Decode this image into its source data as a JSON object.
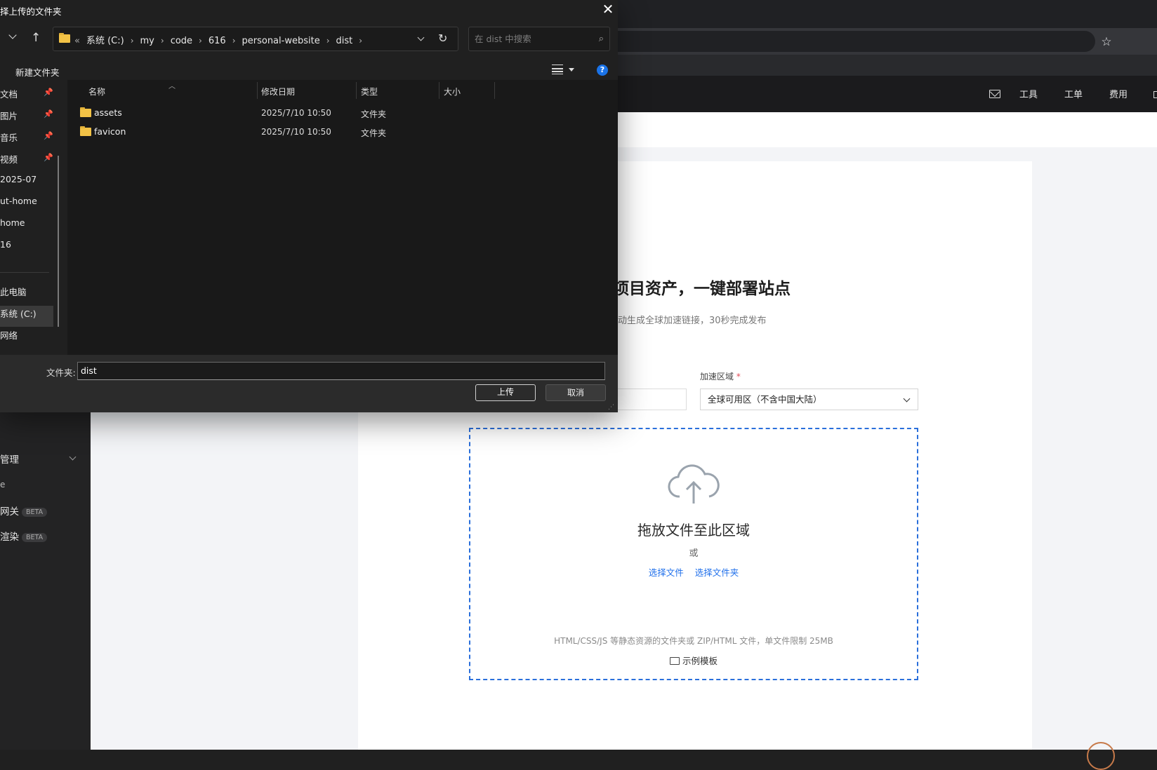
{
  "dialog": {
    "title": "择上传的文件夹",
    "close_glyph": "✕",
    "breadcrumbs": [
      "系统 (C:)",
      "my",
      "code",
      "616",
      "personal-website",
      "dist"
    ],
    "crumb_prefix": "«",
    "search_placeholder": "在 dist 中搜索",
    "new_folder": "新建文件夹",
    "help_glyph": "?",
    "sidebar": [
      {
        "label": "文档",
        "pinned": true
      },
      {
        "label": "图片",
        "pinned": true
      },
      {
        "label": "音乐",
        "pinned": true
      },
      {
        "label": "视频",
        "pinned": true
      },
      {
        "label": "2025-07"
      },
      {
        "label": "ut-home"
      },
      {
        "label": "home"
      },
      {
        "label": "16"
      },
      {
        "label": "此电脑"
      },
      {
        "label": "系统 (C:)",
        "selected": true
      },
      {
        "label": "网络"
      }
    ],
    "columns": {
      "name": "名称",
      "date": "修改日期",
      "type": "类型",
      "size": "大小"
    },
    "files": [
      {
        "name": "assets",
        "date": "2025/7/10 10:50",
        "type": "文件夹"
      },
      {
        "name": "favicon",
        "date": "2025/7/10 10:50",
        "type": "文件夹"
      }
    ],
    "folder_label": "文件夹:",
    "folder_value": "dist",
    "upload_button": "上传",
    "cancel_button": "取消"
  },
  "header": {
    "items": [
      "工具",
      "工单",
      "费用"
    ]
  },
  "left_nav": {
    "section": "管理",
    "items": [
      {
        "label": "e"
      },
      {
        "label": "网关",
        "badge": "BETA"
      },
      {
        "label": "渲染",
        "badge": "BETA"
      }
    ]
  },
  "main": {
    "title": "项目资产，一键部署站点",
    "subtitle": "动生成全球加速链接，30秒完成发布",
    "region_label": "加速区域",
    "required_mark": "*",
    "region_value": "全球可用区（不含中国大陆）",
    "dropzone": {
      "heading": "拖放文件至此区域",
      "or": "或",
      "select_file": "选择文件",
      "select_folder": "选择文件夹",
      "hint": "HTML/CSS/JS 等静态资源的文件夹或 ZIP/HTML 文件，单文件限制 25MB",
      "template": "示例模板"
    }
  },
  "colors": {
    "accent": "#1f6feb",
    "dashed_border": "#2a6fdb",
    "folder": "#f2c246"
  }
}
